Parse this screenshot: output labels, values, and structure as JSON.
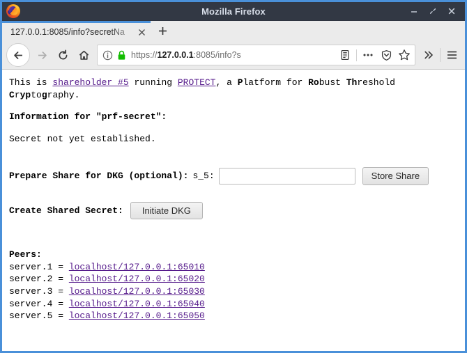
{
  "window": {
    "title": "Mozilla Firefox",
    "controls": {
      "minimize": "minimize",
      "maximize": "restore",
      "close": "close"
    }
  },
  "tabs": [
    {
      "title": "127.0.0.1:8085/info?secretNa",
      "active": true
    }
  ],
  "newtab_label": "+",
  "toolbar": {
    "back": "Back",
    "forward": "Forward",
    "reload": "Reload",
    "home": "Home",
    "url_scheme": "https://",
    "url_host": "127.0.0.1",
    "url_rest": ":8085/info?s",
    "reader_view": "Reader View",
    "page_actions": "Page actions",
    "pocket": "Save to Pocket",
    "bookmark": "Bookmark this page",
    "overflow": "More tools",
    "menu": "Open menu"
  },
  "page": {
    "intro": {
      "prefix": "This is ",
      "link_shareholder": "shareholder #5",
      "middle": " running ",
      "link_protect": "PROTECT",
      "suffix_parts": [
        {
          "text": ", a ",
          "bold": false
        },
        {
          "text": "P",
          "bold": true
        },
        {
          "text": "latform for ",
          "bold": false
        },
        {
          "text": "Ro",
          "bold": true
        },
        {
          "text": "bust ",
          "bold": false
        },
        {
          "text": "Th",
          "bold": true
        },
        {
          "text": "reshold ",
          "bold": false
        },
        {
          "text": "C",
          "bold": true
        },
        {
          "text": "r",
          "bold": false
        },
        {
          "text": "yp",
          "bold": true
        },
        {
          "text": "to",
          "bold": false
        },
        {
          "text": "g",
          "bold": true
        },
        {
          "text": "raphy.",
          "bold": false
        }
      ]
    },
    "info_heading": "Information for \"prf-secret\":",
    "secret_status": "Secret not yet established.",
    "prepare_share_label": "Prepare Share for DKG (optional):",
    "share_field_label": "s_5:",
    "share_input_value": "",
    "share_input_placeholder": "",
    "store_share_button": "Store Share",
    "create_shared_secret_label": "Create Shared Secret:",
    "initiate_dkg_button": "Initiate DKG",
    "peers_heading": "Peers:",
    "peers": [
      {
        "name": "server.1",
        "eq": " = ",
        "address": "localhost/127.0.0.1:65010"
      },
      {
        "name": "server.2",
        "eq": " = ",
        "address": "localhost/127.0.0.1:65020"
      },
      {
        "name": "server.3",
        "eq": " = ",
        "address": "localhost/127.0.0.1:65030"
      },
      {
        "name": "server.4",
        "eq": " = ",
        "address": "localhost/127.0.0.1:65040"
      },
      {
        "name": "server.5",
        "eq": " = ",
        "address": "localhost/127.0.0.1:65050"
      }
    ]
  },
  "colors": {
    "window_border": "#4a90d9",
    "titlebar": "#323844",
    "tabstrip": "#2e3440",
    "toolbar": "#ebebeb",
    "link": "#551a8b",
    "lock_green": "#12bc00",
    "page_bg": "#ffffff"
  }
}
